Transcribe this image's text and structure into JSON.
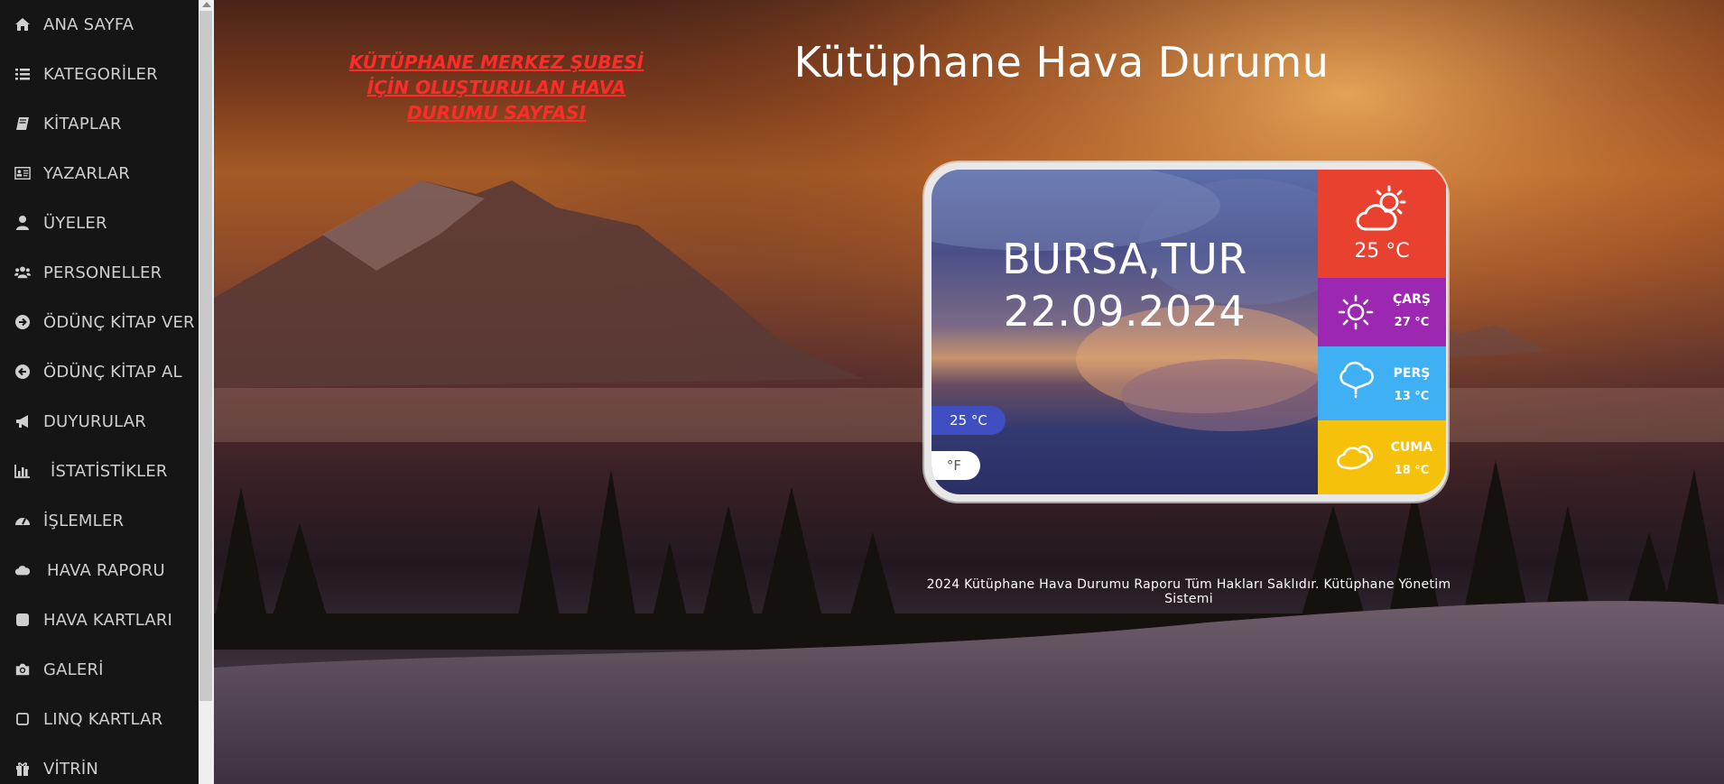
{
  "sidebar": {
    "items": [
      {
        "label": "ANA SAYFA",
        "icon": "home-icon"
      },
      {
        "label": "KATEGORİLER",
        "icon": "list-icon"
      },
      {
        "label": "KİTAPLAR",
        "icon": "book-icon"
      },
      {
        "label": "YAZARLAR",
        "icon": "id-card-icon"
      },
      {
        "label": "ÜYELER",
        "icon": "user-icon"
      },
      {
        "label": "PERSONELLER",
        "icon": "users-icon"
      },
      {
        "label": "ÖDÜNÇ KİTAP VER",
        "icon": "arrow-circle-right-icon"
      },
      {
        "label": "ÖDÜNÇ KİTAP AL",
        "icon": "arrow-circle-left-icon"
      },
      {
        "label": "DUYURULAR",
        "icon": "bullhorn-icon"
      },
      {
        "label": "İSTATİSTİKLER",
        "icon": "bar-chart-icon"
      },
      {
        "label": "İŞLEMLER",
        "icon": "dashboard-icon"
      },
      {
        "label": "HAVA RAPORU",
        "icon": "cloud-icon"
      },
      {
        "label": "HAVA KARTLARI",
        "icon": "square-icon"
      },
      {
        "label": "GALERİ",
        "icon": "camera-icon"
      },
      {
        "label": "LINQ KARTLAR",
        "icon": "square-outline-icon"
      },
      {
        "label": "VİTRİN",
        "icon": "gift-icon"
      }
    ]
  },
  "notice": "KÜTÜPHANE MERKEZ ŞUBESİ İÇİN OLUŞTURULAN HAVA DURUMU SAYFASI",
  "page_title": "Kütüphane Hava Durumu",
  "weather": {
    "city": "BURSA,TUR",
    "date": "22.09.2024",
    "current_temp_pill": "25 °C",
    "unit_toggle": "°F",
    "today": {
      "temp": "25 °C",
      "icon": "partly-cloudy-icon"
    },
    "forecast": [
      {
        "day": "ÇARŞ",
        "temp": "27 °C",
        "icon": "sun-icon",
        "color": "#9c27b0"
      },
      {
        "day": "PERŞ",
        "temp": "13 °C",
        "icon": "rain-cloud-icon",
        "color": "#3fb0f3"
      },
      {
        "day": "CUMA",
        "temp": "18 °C",
        "icon": "cloudy-icon",
        "color": "#f5c10b"
      }
    ],
    "today_color": "#e8412f"
  },
  "footer": "2024 Kütüphane Hava Durumu Raporu Tüm Hakları Saklıdır. Kütüphane Yönetim Sistemi"
}
